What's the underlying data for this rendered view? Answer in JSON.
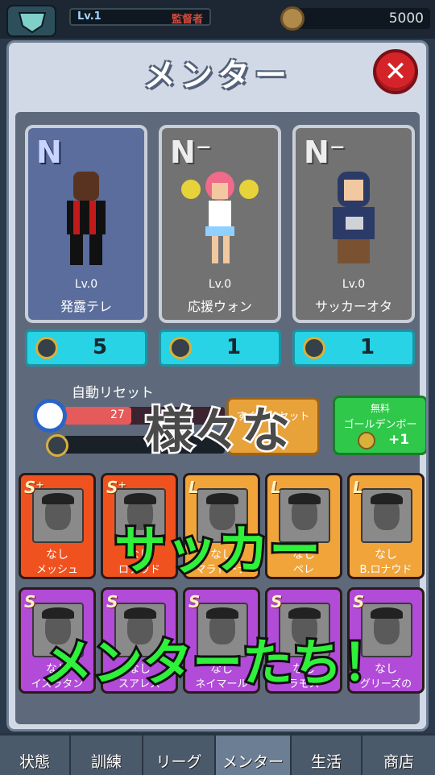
{
  "header": {
    "level": "Lv.1",
    "rank": "監督者",
    "coins": "5000"
  },
  "modal": {
    "title": "メンター",
    "close": "✕"
  },
  "mentors": [
    {
      "rank": "N",
      "level": "Lv.0",
      "name": "発露テレ",
      "cost": "5"
    },
    {
      "rank": "N⁻",
      "level": "Lv.0",
      "name": "応援ウォン",
      "cost": "1"
    },
    {
      "rank": "N⁻",
      "level": "Lv.0",
      "name": "サッカーオタ",
      "cost": "1"
    }
  ],
  "reset": {
    "label": "自動リセット",
    "timer": "27",
    "progress": 0.42,
    "button": "すぐにリセット"
  },
  "free_button": {
    "line1": "無料",
    "line2": "ゴールデンボー",
    "plus": "+1"
  },
  "players": [
    {
      "badge": "S⁺",
      "status": "なし",
      "name": "メッシュ",
      "tier": "ss"
    },
    {
      "badge": "S⁺",
      "status": "なし",
      "name": "ロナウド",
      "tier": "ss"
    },
    {
      "badge": "L",
      "status": "なし",
      "name": "マラドーナ",
      "tier": "l"
    },
    {
      "badge": "L",
      "status": "なし",
      "name": "ペレ",
      "tier": "l"
    },
    {
      "badge": "L",
      "status": "なし",
      "name": "B.ロナウド",
      "tier": "l"
    },
    {
      "badge": "S",
      "status": "なし",
      "name": "イスラタン",
      "tier": "s"
    },
    {
      "badge": "S",
      "status": "なし",
      "name": "スアレス",
      "tier": "s"
    },
    {
      "badge": "S",
      "status": "なし",
      "name": "ネイマール",
      "tier": "s"
    },
    {
      "badge": "S",
      "status": "なし",
      "name": "ラモス",
      "tier": "s"
    },
    {
      "badge": "S",
      "status": "なし",
      "name": "グリーズの",
      "tier": "s"
    }
  ],
  "captions": {
    "line1": "様々な",
    "line2": "サッカー",
    "line3": "メンターたち！"
  },
  "nav": [
    "状態",
    "訓練",
    "リーグ",
    "メンター",
    "生活",
    "商店"
  ],
  "colors": {
    "accent_cyan": "#27d3e5",
    "caption_green": "#2ff03a",
    "close_red": "#d4242a"
  }
}
